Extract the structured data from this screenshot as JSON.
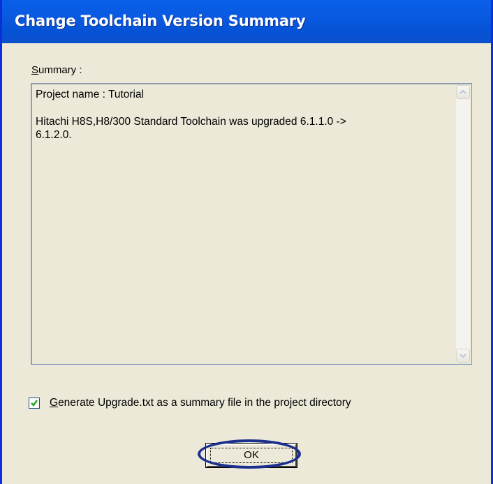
{
  "window": {
    "title": "Change Toolchain Version Summary"
  },
  "summary": {
    "label_hotkey": "S",
    "label_rest": "ummary :",
    "lines": [
      "Project name : Tutorial",
      "Hitachi H8S,H8/300 Standard Toolchain was upgraded 6.1.1.0 ->",
      "6.1.2.0."
    ]
  },
  "checkbox": {
    "checked": true,
    "label_hotkey": "G",
    "label_rest": "enerate Upgrade.txt as a summary file in the project directory"
  },
  "buttons": {
    "ok_label": "OK"
  },
  "icons": {
    "scroll_up": "chevron-up-icon",
    "scroll_down": "chevron-down-icon",
    "check": "checkmark-icon"
  },
  "colors": {
    "titlebar": "#0553d6",
    "dialog_bg": "#ece9d8",
    "highlight_ellipse": "#1b2f8f"
  }
}
